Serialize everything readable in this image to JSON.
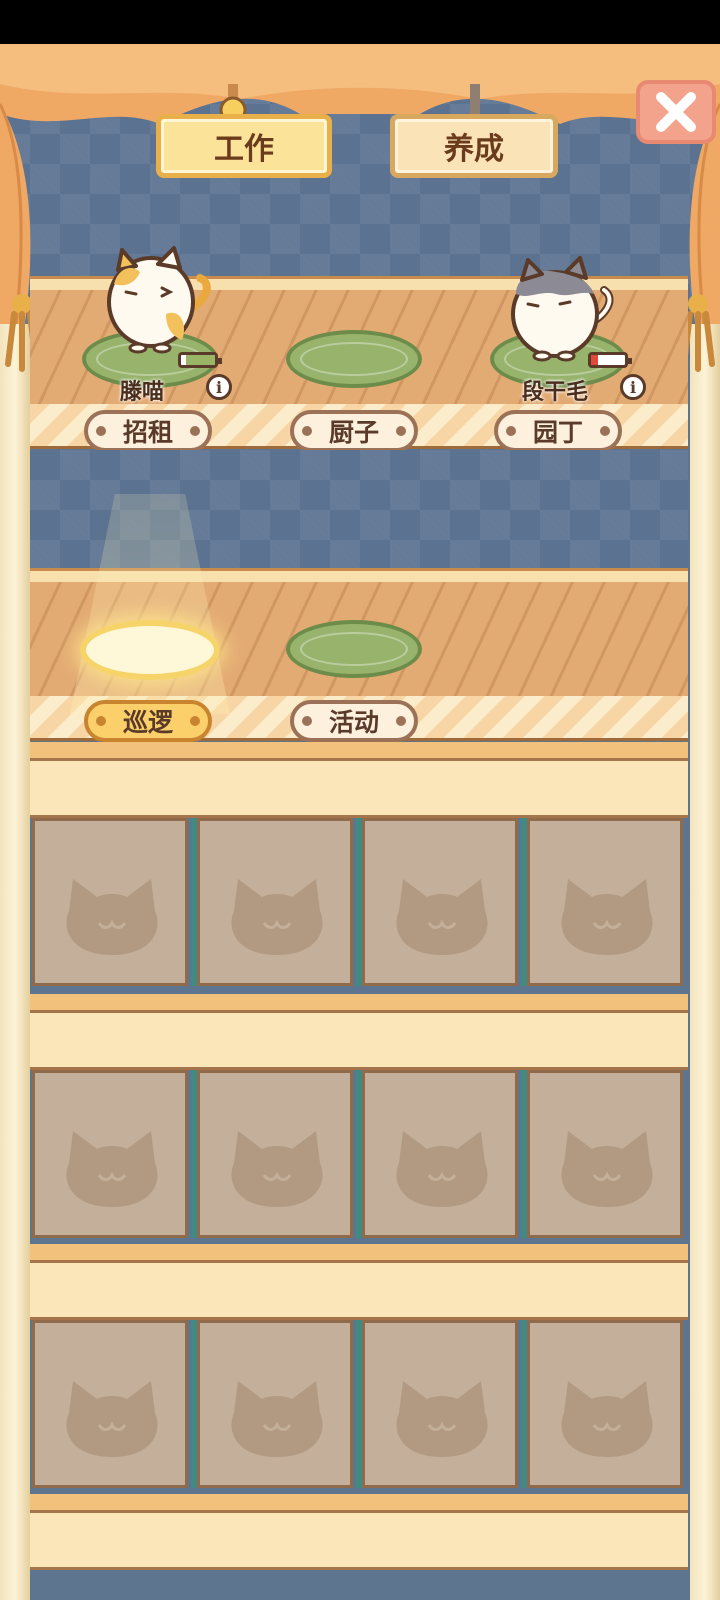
{
  "tabs": [
    {
      "label": "工作",
      "active": true
    },
    {
      "label": "养成",
      "active": false
    }
  ],
  "close_icon": "close-x-icon",
  "work_row_1": {
    "stations": [
      {
        "label": "招租",
        "cat_name": "滕喵",
        "has_cat": true,
        "battery_level": 0.85,
        "battery_color": "#9bb567"
      },
      {
        "label": "厨子",
        "cat_name": "",
        "has_cat": false
      },
      {
        "label": "园丁",
        "cat_name": "段干毛",
        "has_cat": true,
        "battery_level": 0.2,
        "battery_color": "#e0493a"
      }
    ]
  },
  "work_row_2": {
    "stations": [
      {
        "label": "巡逻",
        "active": true
      },
      {
        "label": "活动",
        "active": false
      }
    ]
  },
  "slot_icon": "cat-silhouette-icon",
  "colors": {
    "accent": "#e9b04a",
    "wall": "#5b7391",
    "floor": "#e3ab74",
    "shelf_divider": "#3f8a82"
  }
}
